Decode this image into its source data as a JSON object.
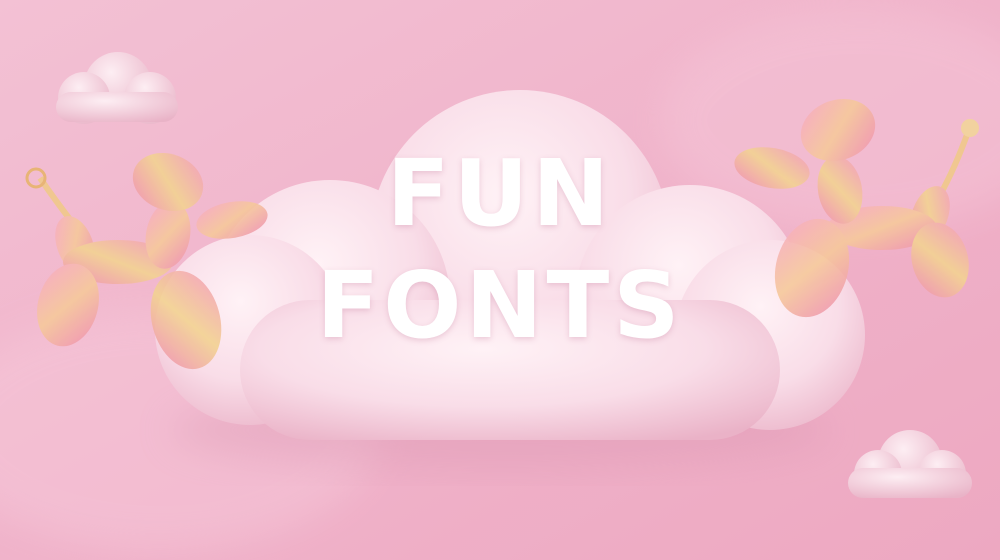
{
  "banner": {
    "title_line1": "FUN",
    "title_line2": "FONTS"
  },
  "colors": {
    "background": "#f1b8ce",
    "cloud": "#fbe3ec",
    "balloon_pink": "#f29bbb",
    "balloon_gold": "#f3d08a",
    "text": "#ffffff"
  },
  "icons": [
    "cloud-icon",
    "balloon-dog-icon"
  ]
}
